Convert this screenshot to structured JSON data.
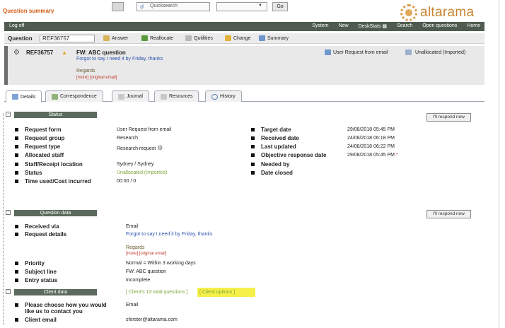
{
  "app": {
    "title": "Question summary"
  },
  "topbar": {
    "search_value": "Quicksearch",
    "go_label": "Go"
  },
  "logo": {
    "text": "altarama"
  },
  "nav": {
    "logoff": "Log off",
    "items": [
      "System",
      "New",
      "DeskStats",
      "Search",
      "Open questions",
      "Home"
    ]
  },
  "question_bar": {
    "label": "Question",
    "value": "REF36757",
    "buttons": [
      "Answer",
      "Reallocate",
      "Qutilities",
      "Change",
      "Summary"
    ]
  },
  "summary": {
    "ref": "REF36757",
    "subject": "FW: ABC question",
    "line2": "Forgot to say I need it by Friday, thanks",
    "regards": "Regards",
    "links": "[more] [original email]",
    "source": "User Request from email",
    "allocation": "Unallocated (Imported)"
  },
  "tabs": [
    "Details",
    "Correspondence",
    "Journal",
    "Resources",
    "History"
  ],
  "status": {
    "heading": "Status",
    "respond": "I'll respond now",
    "left": [
      {
        "label": "Request form",
        "value": "User Request from email"
      },
      {
        "label": "Request group",
        "value": "Research"
      },
      {
        "label": "Request type",
        "value": "Research request"
      },
      {
        "label": "Allocated staff",
        "value": ""
      },
      {
        "label": "Staff/Receipt location",
        "value": "Sydney / Sydney"
      },
      {
        "label": "Status",
        "value": "Unallocated (Imported)"
      },
      {
        "label": "Time used/Cost incurred",
        "value": "00:00 / 0"
      }
    ],
    "right": [
      {
        "label": "Target date",
        "value": "29/08/2018 05:45 PM"
      },
      {
        "label": "Received date",
        "value": "24/08/2018 06:18 PM"
      },
      {
        "label": "Last updated",
        "value": "24/08/2018 06:22 PM"
      },
      {
        "label": "Objective response date",
        "value": "29/08/2018 05:45 PM"
      },
      {
        "label": "Needed by",
        "value": ""
      },
      {
        "label": "Date closed",
        "value": ""
      }
    ]
  },
  "question_data": {
    "heading": "Question data",
    "respond": "I'll respond now",
    "received_via_label": "Received via",
    "received_via": "Email",
    "details_label": "Request details",
    "details": "Forgot to say I need it by Friday, thanks",
    "regards": "Regards",
    "links": "[more] [original email]",
    "priority_label": "Priority",
    "priority": "Normal = Within 3 working days",
    "subject_label": "Subject line",
    "subject": "FW: ABC question",
    "entry_label": "Entry status",
    "entry": "Incomplete"
  },
  "client_data": {
    "heading": "Client data",
    "client_questions": "[ Client's 13 total questions ]",
    "client_options": "[ Client options ]",
    "contact_label_1": "Please choose how you would",
    "contact_label_2": "like us to contact you",
    "contact": "Email",
    "email_label": "Client email",
    "email": "sforster@altarama.com"
  }
}
